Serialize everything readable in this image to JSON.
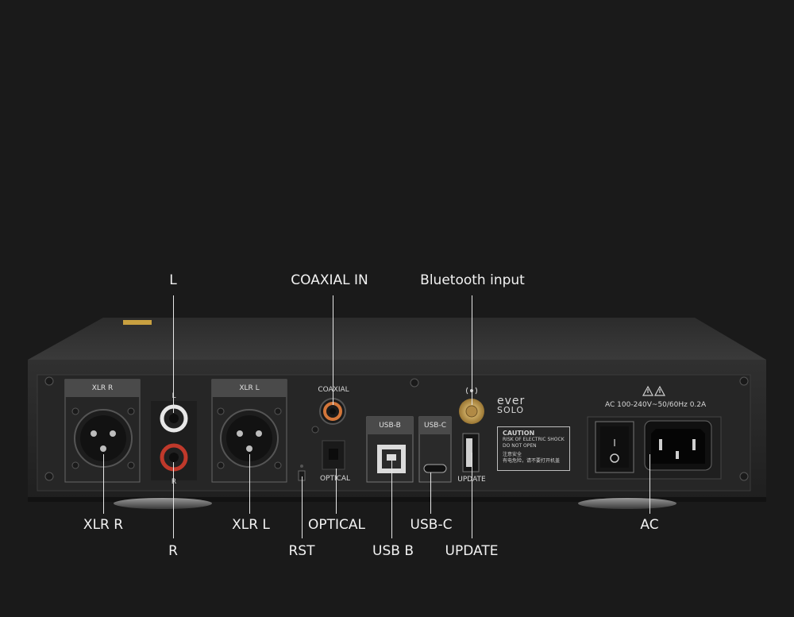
{
  "callouts": {
    "l": "L",
    "coaxial_in": "COAXIAL IN",
    "bluetooth_input": "Bluetooth input",
    "xlr_r": "XLR R",
    "r": "R",
    "xlr_l": "XLR L",
    "rst": "RST",
    "optical": "OPTICAL",
    "usb_b": "USB B",
    "usb_c": "USB-C",
    "update": "UPDATE",
    "ac": "AC"
  },
  "panel": {
    "xlr_r_tab": "XLR R",
    "xlr_l_tab": "XLR L",
    "rca_l": "L",
    "rca_r": "R",
    "coaxial": "COAXIAL",
    "optical": "OPTICAL",
    "usb_b_tab": "USB-B",
    "usb_c_tab": "USB-C",
    "update": "UPDATE",
    "brand_top": "ever",
    "brand_bottom": "SOLO",
    "power_rating": "AC 100-240V~50/60Hz 0.2A",
    "switch_on": "I",
    "caution_title": "CAUTION",
    "caution_line1": "RISK OF ELECTRIC SHOCK",
    "caution_line2": "DO NOT OPEN",
    "caution_cn_title": "注意安全",
    "caution_cn_line": "有电危险，请不要打开机盖"
  },
  "colors": {
    "background": "#1a1a1a",
    "chassis": "#2a2a2a",
    "callout_text": "#f2f2f2",
    "rca_white": "#e8e8e8",
    "rca_red": "#c0392b",
    "gold": "#c9a45a"
  }
}
